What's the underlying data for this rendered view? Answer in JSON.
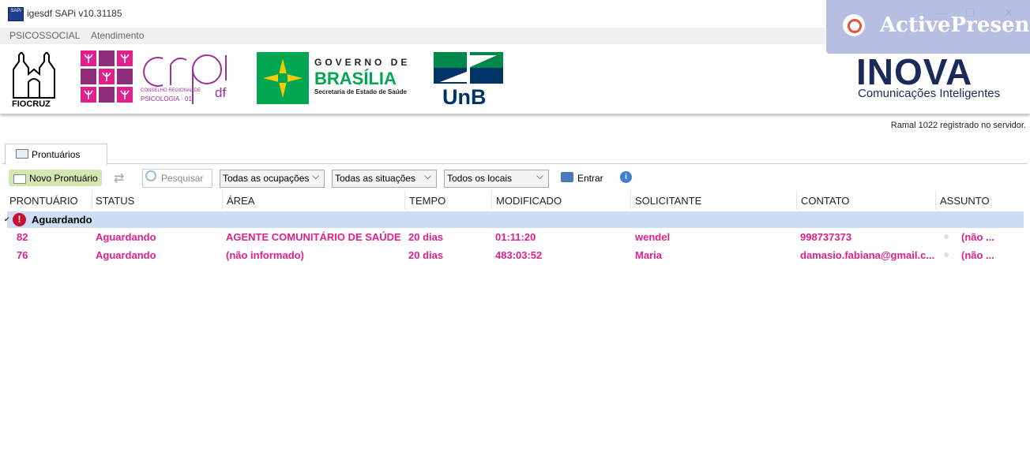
{
  "window": {
    "app_icon_text": "SAPi",
    "title": "igesdf SAPi v10.31185",
    "minimize_glyph": "—",
    "maximize_glyph": "☐",
    "close_glyph": "✕"
  },
  "menu": [
    {
      "label": "PSICOSSOCIAL"
    },
    {
      "label": "Atendimento"
    }
  ],
  "watermark": {
    "text": "ActivePresent"
  },
  "banner": {
    "fiocruz": "FIOCRUZ",
    "crp_small": "CONSELHO REGIONAL DE",
    "crp_big": "PSICOLOGIA · 01",
    "crp_df": "df",
    "gov_line1": "GOVERNO DE",
    "gov_line2": "BRASÍLIA",
    "gov_line3": "Secretaria de Estado de Saúde",
    "unb": "UnB",
    "inova": "INOVA",
    "inova_sub": "Comunicações Inteligentes"
  },
  "status": "Ramal 1022 registrado no servidor.",
  "tabs": [
    {
      "label": "Prontuários"
    }
  ],
  "toolbar": {
    "new_label": "Novo Prontuário",
    "search_placeholder": "Pesquisar",
    "filter_occupations": "Todas as ocupações",
    "filter_situations": "Todas as situações",
    "filter_locations": "Todos os locais",
    "enter_label": "Entrar",
    "info_glyph": "i"
  },
  "table": {
    "columns": [
      "PRONTUÁRIO",
      "STATUS",
      "ÁREA",
      "TEMPO",
      "MODIFICADO",
      "SOLICITANTE",
      "CONTATO",
      "ASSUNTO"
    ],
    "group": {
      "label": "Aguardando",
      "icon_glyph": "!"
    },
    "rows": [
      {
        "prontuario": "82",
        "status": "Aguardando",
        "area": "AGENTE COMUNITÁRIO DE SAÚDE",
        "tempo": "20 dias",
        "modificado": "01:11:20",
        "solicitante": "wendel",
        "contato": "998737373",
        "assunto": "(não ..."
      },
      {
        "prontuario": "76",
        "status": "Aguardando",
        "area": "(não informado)",
        "tempo": "20 dias",
        "modificado": "483:03:52",
        "solicitante": "Maria",
        "contato": "damasio.fabiana@gmail.c...",
        "assunto": "(não ..."
      }
    ]
  },
  "colors": {
    "row_text": "#e0208c",
    "group_bg": "#cfdcf5",
    "accent_green": "#d3e8b0"
  }
}
